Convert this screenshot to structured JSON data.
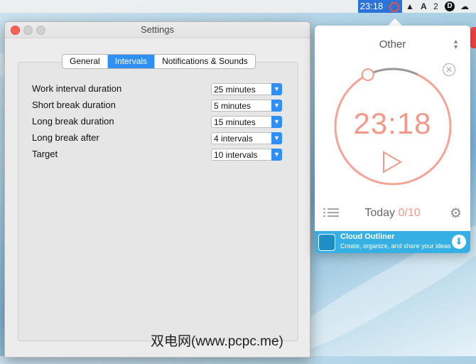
{
  "menubar": {
    "time": "23:18",
    "items": [
      "▲",
      "A",
      "2",
      "D"
    ]
  },
  "settings": {
    "title": "Settings",
    "tabs": [
      {
        "label": "General"
      },
      {
        "label": "Intervals"
      },
      {
        "label": "Notifications & Sounds"
      }
    ],
    "rows": [
      {
        "label": "Work interval duration",
        "value": "25 minutes"
      },
      {
        "label": "Short break duration",
        "value": "5 minutes"
      },
      {
        "label": "Long break duration",
        "value": "15 minutes"
      },
      {
        "label": "Long break after",
        "value": "4 intervals"
      },
      {
        "label": "Target",
        "value": "10 intervals"
      }
    ]
  },
  "timer": {
    "category": "Other",
    "time": "23:18",
    "today_label": "Today",
    "today_count": "0/10",
    "progress": 0.07
  },
  "ad": {
    "title": "Cloud Outliner",
    "subtitle": "Create, organize, and share your ideas"
  },
  "watermark": "双电网(www.pcpc.me)",
  "colors": {
    "accent": "#2f8ff5",
    "timer": "#f29a8a",
    "ad": "#36b0e2"
  }
}
